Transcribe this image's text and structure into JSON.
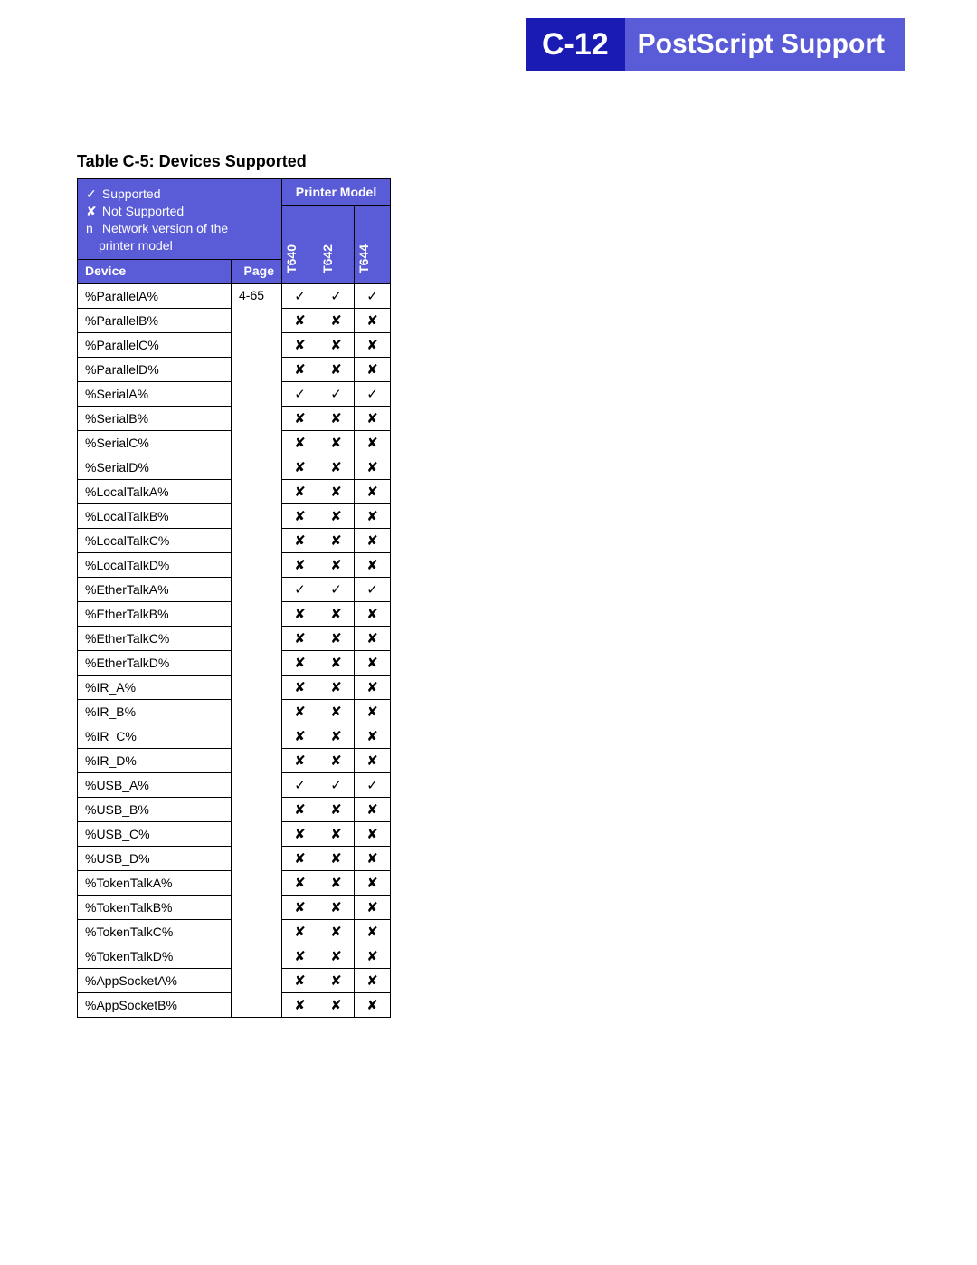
{
  "header": {
    "section_code": "C-12",
    "section_title": "PostScript Support"
  },
  "table": {
    "title": "Table C-5:  Devices Supported",
    "legend": {
      "supported_symbol": "✓",
      "supported_label": "Supported",
      "not_supported_symbol": "✘",
      "not_supported_label": "Not Supported",
      "network_symbol": "n",
      "network_label_line1": "Network version  of the",
      "network_label_line2": "printer model"
    },
    "column_headers": {
      "printer_model": "Printer Model",
      "device": "Device",
      "page": "Page",
      "models": [
        "T640",
        "T642",
        "T644"
      ]
    },
    "page_value": "4-65",
    "rows": [
      {
        "device": "%ParallelA%",
        "t640": "✓",
        "t642": "✓",
        "t644": "✓"
      },
      {
        "device": "%ParallelB%",
        "t640": "✘",
        "t642": "✘",
        "t644": "✘"
      },
      {
        "device": "%ParallelC%",
        "t640": "✘",
        "t642": "✘",
        "t644": "✘"
      },
      {
        "device": "%ParallelD%",
        "t640": "✘",
        "t642": "✘",
        "t644": "✘"
      },
      {
        "device": "%SerialA%",
        "t640": "✓",
        "t642": "✓",
        "t644": "✓"
      },
      {
        "device": "%SerialB%",
        "t640": "✘",
        "t642": "✘",
        "t644": "✘"
      },
      {
        "device": "%SerialC%",
        "t640": "✘",
        "t642": "✘",
        "t644": "✘"
      },
      {
        "device": "%SerialD%",
        "t640": "✘",
        "t642": "✘",
        "t644": "✘"
      },
      {
        "device": "%LocalTalkA%",
        "t640": "✘",
        "t642": "✘",
        "t644": "✘"
      },
      {
        "device": "%LocalTalkB%",
        "t640": "✘",
        "t642": "✘",
        "t644": "✘"
      },
      {
        "device": "%LocalTalkC%",
        "t640": "✘",
        "t642": "✘",
        "t644": "✘"
      },
      {
        "device": "%LocalTalkD%",
        "t640": "✘",
        "t642": "✘",
        "t644": "✘"
      },
      {
        "device": "%EtherTalkA%",
        "t640": "✓",
        "t642": "✓",
        "t644": "✓"
      },
      {
        "device": "%EtherTalkB%",
        "t640": "✘",
        "t642": "✘",
        "t644": "✘"
      },
      {
        "device": "%EtherTalkC%",
        "t640": "✘",
        "t642": "✘",
        "t644": "✘"
      },
      {
        "device": "%EtherTalkD%",
        "t640": "✘",
        "t642": "✘",
        "t644": "✘"
      },
      {
        "device": "%IR_A%",
        "t640": "✘",
        "t642": "✘",
        "t644": "✘"
      },
      {
        "device": "%IR_B%",
        "t640": "✘",
        "t642": "✘",
        "t644": "✘"
      },
      {
        "device": "%IR_C%",
        "t640": "✘",
        "t642": "✘",
        "t644": "✘"
      },
      {
        "device": "%IR_D%",
        "t640": "✘",
        "t642": "✘",
        "t644": "✘"
      },
      {
        "device": "%USB_A%",
        "t640": "✓",
        "t642": "✓",
        "t644": "✓"
      },
      {
        "device": "%USB_B%",
        "t640": "✘",
        "t642": "✘",
        "t644": "✘"
      },
      {
        "device": "%USB_C%",
        "t640": "✘",
        "t642": "✘",
        "t644": "✘"
      },
      {
        "device": "%USB_D%",
        "t640": "✘",
        "t642": "✘",
        "t644": "✘"
      },
      {
        "device": "%TokenTalkA%",
        "t640": "✘",
        "t642": "✘",
        "t644": "✘"
      },
      {
        "device": "%TokenTalkB%",
        "t640": "✘",
        "t642": "✘",
        "t644": "✘"
      },
      {
        "device": "%TokenTalkC%",
        "t640": "✘",
        "t642": "✘",
        "t644": "✘"
      },
      {
        "device": "%TokenTalkD%",
        "t640": "✘",
        "t642": "✘",
        "t644": "✘"
      },
      {
        "device": "%AppSocketA%",
        "t640": "✘",
        "t642": "✘",
        "t644": "✘"
      },
      {
        "device": "%AppSocketB%",
        "t640": "✘",
        "t642": "✘",
        "t644": "✘"
      }
    ]
  }
}
